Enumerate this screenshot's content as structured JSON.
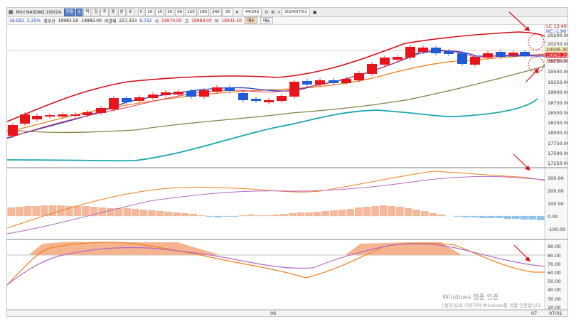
{
  "toolbar": {
    "symbol_icon": "grid-icon",
    "symbol": "Mini NASDAQ 100(24.",
    "chart_type_buttons": [
      "연결",
      "S",
      "틱",
      "일",
      "주",
      "월",
      "분",
      "초"
    ],
    "interval_buttons": [
      "5",
      "10",
      "15",
      "30",
      "60",
      "120",
      "180",
      "240"
    ],
    "count_value": "30",
    "bars_value": "44/263",
    "date_value": "2024/07/01",
    "calendar_icon": "calendar-icon"
  },
  "price_line": {
    "change": "16.502",
    "change_pct": "2.25%",
    "bid_label": "최우선",
    "bid": "19983.50",
    "ask": "19983.00",
    "vol_label": "미결제",
    "vol": "237,333",
    "vol_change": "6,722",
    "open_label": "시",
    "open": "19970.00",
    "high_label": "고",
    "high": "19989.00",
    "low_label": "저",
    "low": "19931.50",
    "tag_buy": "매수",
    "tag_sell": "매도"
  },
  "chart_labels": {
    "lc": "LC 13.46",
    "hc": "HC -1.90",
    "price_tag_1": "20035.30",
    "price_tag_2": "19983.25",
    "price_tag_3": "19938.00"
  },
  "price_axis": [
    "20500.00",
    "20250.00",
    "19750.00",
    "19500.00",
    "19250.00",
    "19000.00",
    "18750.00",
    "18500.00",
    "18250.00",
    "18000.00",
    "17750.00",
    "17500.00",
    "17250.00"
  ],
  "macd_axis": [
    "300.00",
    "200.00",
    "100.00",
    "0.00",
    "-100.00"
  ],
  "stoch_axis": [
    "90.00",
    "80.00",
    "70.00",
    "60.00",
    "50.00",
    "40.00",
    "30.00",
    "20.00"
  ],
  "time_axis": [
    "06",
    "07",
    "07/01"
  ],
  "watermark": {
    "line1": "Windows 정품 인증",
    "line2": "[설정]으로 이동하여 Windows를 정품 인증합니다."
  },
  "colors": {
    "up_candle": "#e8141c",
    "down_candle": "#1f5bd6",
    "bollinger": "#d3101a",
    "ma_orange": "#f07f20",
    "ma_olive": "#7a7040",
    "ma_teal": "#1aa5b0",
    "histogram_pos": "#f5b89a",
    "histogram_neg": "#8fc6ee",
    "annotation": "#e01010"
  }
}
